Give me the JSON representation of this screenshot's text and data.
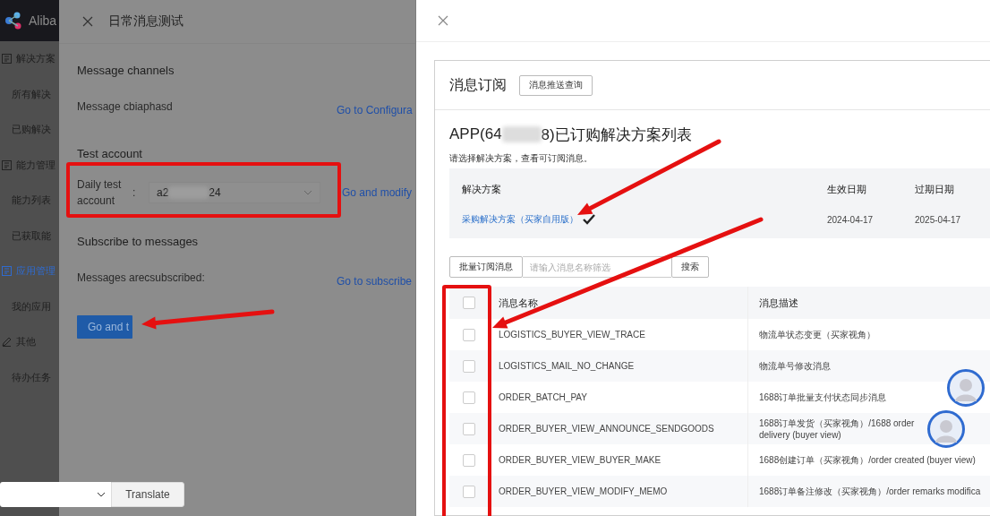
{
  "sidebar": {
    "logo": "Aliba",
    "items": [
      {
        "label": "解决方案",
        "kind": "group",
        "selected": false
      },
      {
        "label": "所有解决",
        "kind": "item",
        "selected": false
      },
      {
        "label": "已购解决",
        "kind": "item",
        "selected": false
      },
      {
        "label": "能力管理",
        "kind": "group",
        "selected": false
      },
      {
        "label": "能力列表",
        "kind": "item",
        "selected": false
      },
      {
        "label": "已获取能",
        "kind": "item",
        "selected": false
      },
      {
        "label": "应用管理",
        "kind": "group",
        "selected": true
      },
      {
        "label": "我的应用",
        "kind": "item",
        "selected": false
      },
      {
        "label": "其他",
        "kind": "edit",
        "selected": false
      },
      {
        "label": "待办任务",
        "kind": "item",
        "selected": false
      }
    ]
  },
  "drawer": {
    "title": "日常消息测试",
    "sections": [
      {
        "heading": "Message channels",
        "kind": "link_row",
        "label": "Message cbiaphasd",
        "link": "Go to Configura"
      },
      {
        "heading": "Test account",
        "kind": "select_row",
        "label": "Daily test account",
        "colon": ":",
        "value_start": "a2",
        "value_end": "24",
        "link": "Go and modify"
      },
      {
        "heading": "Subscribe to messages",
        "kind": "link_row",
        "label": "Messages arecsubscribed:",
        "link": "Go to subscribe"
      }
    ],
    "button": "Go and t"
  },
  "subscription": {
    "title": "消息订阅",
    "query_button": "消息推送查询",
    "list_title_start": "APP(64",
    "list_title_end": "8)已订购解决方案列表",
    "hint": "请选择解决方案，查看可订阅消息。",
    "solutions": {
      "columns": [
        "解决方案",
        "生效日期",
        "过期日期"
      ],
      "rows": [
        {
          "name": "采购解决方案（买家自用版）",
          "selected": true,
          "start": "2024-04-17",
          "end": "2025-04-17"
        }
      ]
    },
    "batch_button": "批量订阅消息",
    "search": {
      "placeholder": "请输入消息名称筛选"
    },
    "search_button": "搜索",
    "messages": {
      "columns": [
        "消息名称",
        "消息描述"
      ],
      "header_checked": false,
      "rows": [
        {
          "name": "LOGISTICS_BUYER_VIEW_TRACE",
          "description": "物流单状态变更（买家视角）",
          "checked": false
        },
        {
          "name": "LOGISTICS_MAIL_NO_CHANGE",
          "description": "物流单号修改消息",
          "checked": false
        },
        {
          "name": "ORDER_BATCH_PAY",
          "description": "1688订单批量支付状态同步消息",
          "checked": false
        },
        {
          "name": "ORDER_BUYER_VIEW_ANNOUNCE_SENDGOODS",
          "description": "1688订单发货（买家视角）/1688 order delivery (buyer view)",
          "checked": false
        },
        {
          "name": "ORDER_BUYER_VIEW_BUYER_MAKE",
          "description": "1688创建订单（买家视角）/order created (buyer view)",
          "checked": false
        },
        {
          "name": "ORDER_BUYER_VIEW_MODIFY_MEMO",
          "description": "1688订单备注修改（买家视角）/order remarks modifica",
          "checked": false
        }
      ]
    }
  },
  "translate_widget": {
    "button": "Translate"
  }
}
